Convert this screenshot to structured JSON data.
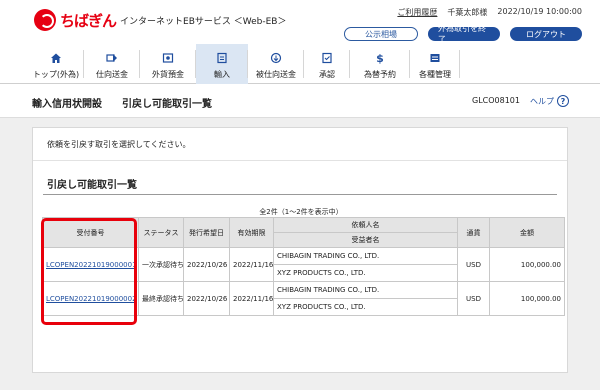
{
  "header": {
    "brand": "ちばぎん",
    "service": "インターネットEBサービス ＜Web-EB＞",
    "usage_link": "ご利用履歴",
    "user": "千葉太郎様",
    "datetime": "2022/10/19 10:00:00",
    "buttons": {
      "rates": "公示相場",
      "end_fx": "外為取引を終了",
      "logout": "ログアウト"
    }
  },
  "nav": [
    {
      "label": "トップ(外為)",
      "icon": "home-icon",
      "active": false
    },
    {
      "label": "仕向送金",
      "icon": "remit-out-icon",
      "active": false
    },
    {
      "label": "外貨預金",
      "icon": "deposit-icon",
      "active": false
    },
    {
      "label": "輸入",
      "icon": "import-icon",
      "active": true
    },
    {
      "label": "被仕向送金",
      "icon": "remit-in-icon",
      "active": false
    },
    {
      "label": "承認",
      "icon": "approval-icon",
      "active": false
    },
    {
      "label": "為替予約",
      "icon": "fx-contract-icon",
      "active": false
    },
    {
      "label": "各種管理",
      "icon": "management-icon",
      "active": false
    }
  ],
  "titlebar": {
    "crumb1": "輸入信用状開設",
    "crumb2": "引戻し可能取引一覧",
    "screen_id": "GLCO08101",
    "help": "ヘルプ",
    "help_mark": "?"
  },
  "main": {
    "instruction": "依頼を引戻す取引を選択してください。",
    "section_title": "引戻し可能取引一覧",
    "count": "全2件（1～2件を表示中）",
    "columns": {
      "ref": "受付番号",
      "status": "ステータス",
      "issue_date": "発行希望日",
      "expiry": "有効期限",
      "applicant": "依頼人名",
      "beneficiary": "受益者名",
      "currency": "通貨",
      "amount": "金額"
    },
    "rows": [
      {
        "ref": "LCOPEN20221019000001",
        "status": "一次承認待ち",
        "issue_date": "2022/10/26",
        "expiry": "2022/11/16",
        "applicant": "CHIBAGIN TRADING CO., LTD.",
        "beneficiary": "XYZ PRODUCTS CO., LTD.",
        "currency": "USD",
        "amount": "100,000.00"
      },
      {
        "ref": "LCOPEN20221019000002",
        "status": "最終承認待ち",
        "issue_date": "2022/10/26",
        "expiry": "2022/11/16",
        "applicant": "CHIBAGIN TRADING CO., LTD.",
        "beneficiary": "XYZ PRODUCTS CO., LTD.",
        "currency": "USD",
        "amount": "100,000.00"
      }
    ]
  },
  "colors": {
    "brand_red": "#e60012",
    "accent_blue": "#1f4e9e",
    "highlight_red": "#e8000b"
  }
}
